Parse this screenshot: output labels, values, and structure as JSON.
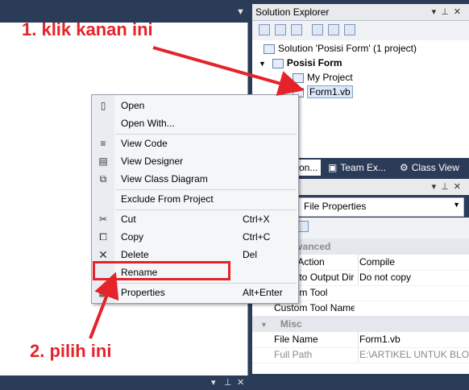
{
  "solution_explorer": {
    "title": "Solution Explorer",
    "tree": {
      "solution": "Solution 'Posisi Form' (1 project)",
      "project": "Posisi Form",
      "my_project": "My Project",
      "form": "Form1.vb"
    }
  },
  "tabs": [
    {
      "label": "tion..."
    },
    {
      "label": "Team Ex..."
    },
    {
      "label": "Class View"
    }
  ],
  "properties": {
    "selected": "File Properties",
    "categories": {
      "advanced": "Advanced",
      "misc": "Misc"
    },
    "rows": [
      {
        "name": "Build Action",
        "value": "Compile"
      },
      {
        "name": "Copy to Output Directory",
        "value": "Do not copy"
      },
      {
        "name": "Custom Tool",
        "value": ""
      },
      {
        "name": "Custom Tool Namespace",
        "value": ""
      },
      {
        "name": "File Name",
        "value": "Form1.vb"
      },
      {
        "name": "Full Path",
        "value": "E:\\ARTIKEL UNTUK BLOG"
      }
    ]
  },
  "context_menu": {
    "items": [
      {
        "label": "Open",
        "shortcut": "",
        "icon": "open-icon"
      },
      {
        "label": "Open With...",
        "shortcut": "",
        "icon": ""
      },
      {
        "label": "View Code",
        "shortcut": "",
        "icon": "code-icon"
      },
      {
        "label": "View Designer",
        "shortcut": "",
        "icon": "designer-icon"
      },
      {
        "label": "View Class Diagram",
        "shortcut": "",
        "icon": "class-diagram-icon"
      },
      {
        "label": "Exclude From Project",
        "shortcut": "",
        "icon": ""
      },
      {
        "label": "Cut",
        "shortcut": "Ctrl+X",
        "icon": "cut-icon"
      },
      {
        "label": "Copy",
        "shortcut": "Ctrl+C",
        "icon": "copy-icon"
      },
      {
        "label": "Delete",
        "shortcut": "Del",
        "icon": "delete-icon"
      },
      {
        "label": "Rename",
        "shortcut": "",
        "icon": ""
      },
      {
        "label": "Properties",
        "shortcut": "Alt+Enter",
        "icon": "properties-icon"
      }
    ]
  },
  "annotations": {
    "step1": "1. klik kanan ini",
    "step2": "2. pilih ini",
    "color": "#e4232a"
  },
  "colors": {
    "ide_background": "#2b3c59",
    "selection": "#dbe7fb"
  }
}
